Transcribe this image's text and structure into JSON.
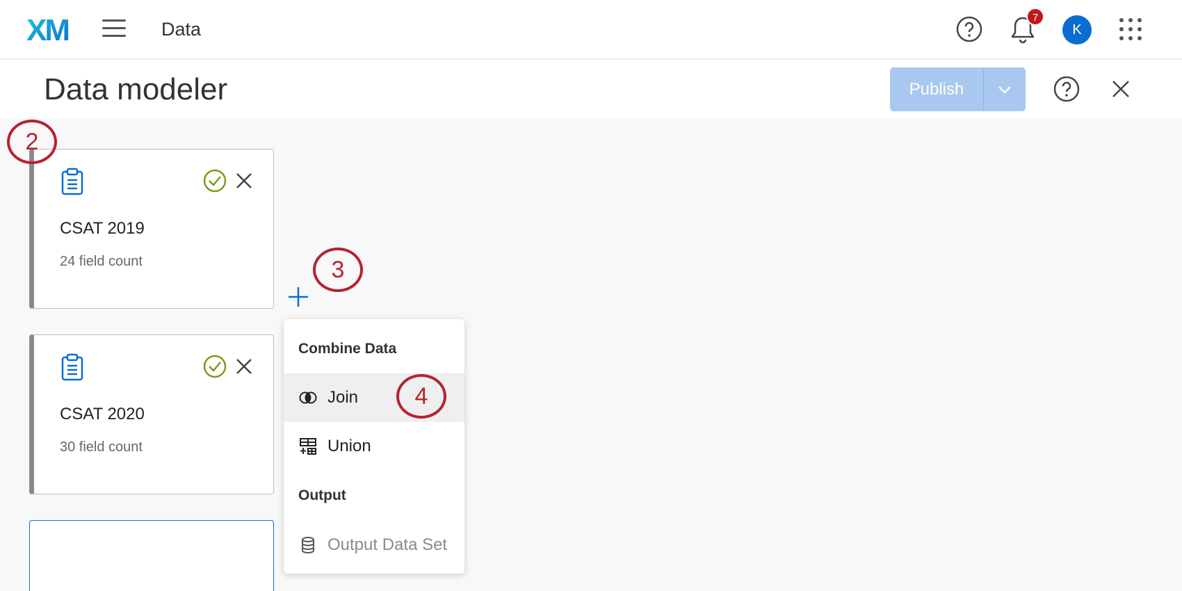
{
  "app": {
    "logo_text": "XM",
    "title": "Data",
    "notifications_count": "7",
    "user_initial": "K"
  },
  "page": {
    "title": "Data modeler",
    "publish_label": "Publish"
  },
  "sources": [
    {
      "name": "CSAT 2019",
      "field_count": "24 field count"
    },
    {
      "name": "CSAT 2020",
      "field_count": "30 field count"
    }
  ],
  "menu": {
    "combine_heading": "Combine Data",
    "join_label": "Join",
    "union_label": "Union",
    "output_heading": "Output",
    "output_label": "Output Data Set"
  },
  "steps": [
    "2",
    "3",
    "4"
  ],
  "colors": {
    "brand_blue": "#0b6cd1",
    "callout_red": "#b5232f",
    "check_green": "#7a9b1b",
    "publish_disabled": "#a9c8ef"
  },
  "icons": [
    "hamburger-icon",
    "help-icon",
    "bell-icon",
    "apps-grid-icon",
    "chevron-down-icon",
    "close-icon",
    "clipboard-icon",
    "check-circle-icon",
    "plus-icon",
    "join-icon",
    "union-icon",
    "database-icon"
  ]
}
